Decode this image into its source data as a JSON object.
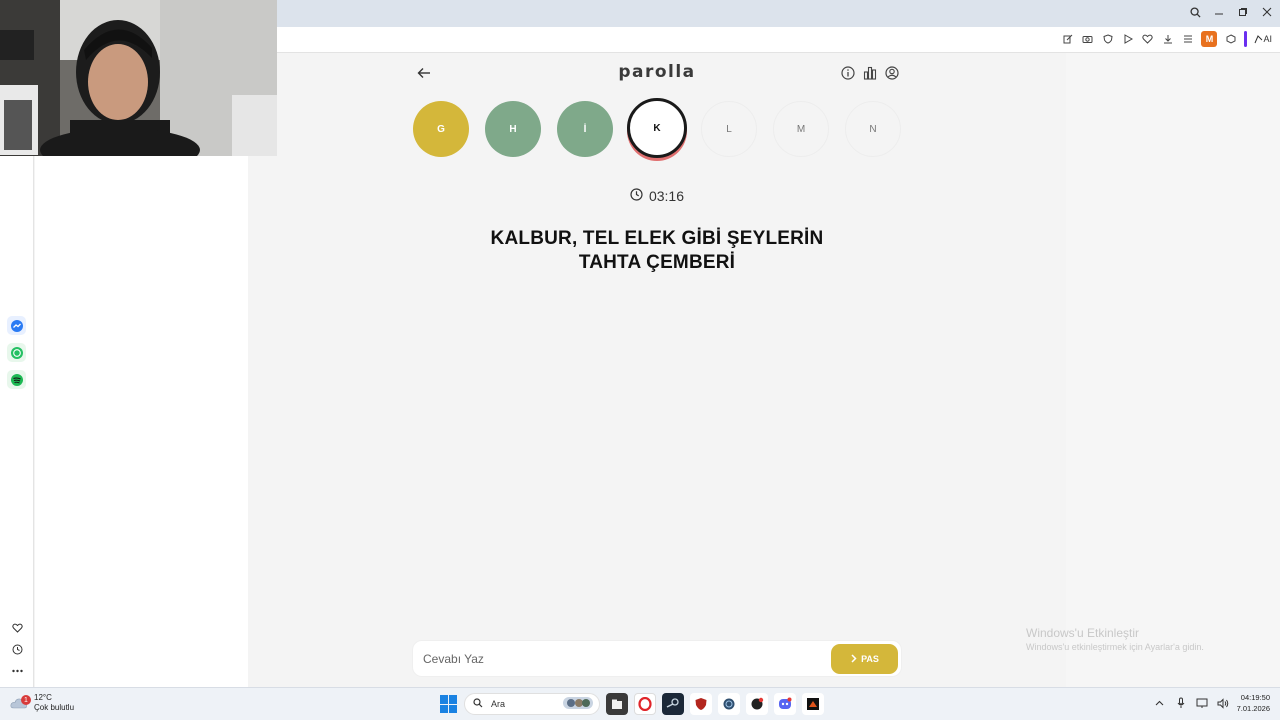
{
  "browser": {
    "toolbar_avatar": "M",
    "ai_label": "AI"
  },
  "game": {
    "logo": "parolla",
    "timer": "03:16",
    "question_line1": "KALBUR, TEL ELEK GİBİ ŞEYLERİN",
    "question_line2": "TAHTA ÇEMBERİ",
    "letters": [
      {
        "letter": "G",
        "state": "correct-yellow"
      },
      {
        "letter": "H",
        "state": "correct-green"
      },
      {
        "letter": "İ",
        "state": "correct-green"
      },
      {
        "letter": "K",
        "state": "active"
      },
      {
        "letter": "L",
        "state": "pending"
      },
      {
        "letter": "M",
        "state": "pending"
      },
      {
        "letter": "N",
        "state": "pending"
      }
    ],
    "answer_placeholder": "Cevabı Yaz",
    "pass_label": "PAS"
  },
  "watermark": {
    "title": "Windows'u Etkinleştir",
    "subtitle": "Windows'u etkinleştirmek için Ayarlar'a gidin."
  },
  "taskbar": {
    "weather_temp": "12°C",
    "weather_desc": "Çok bulutlu",
    "weather_badge": "1",
    "search_placeholder": "Ara",
    "time": "04:19:50",
    "date": "7.01.2026"
  },
  "colors": {
    "yellow": "#d4b73a",
    "green": "#7fa98a",
    "active_border": "#1a1a1a",
    "active_shadow": "#e07070"
  }
}
